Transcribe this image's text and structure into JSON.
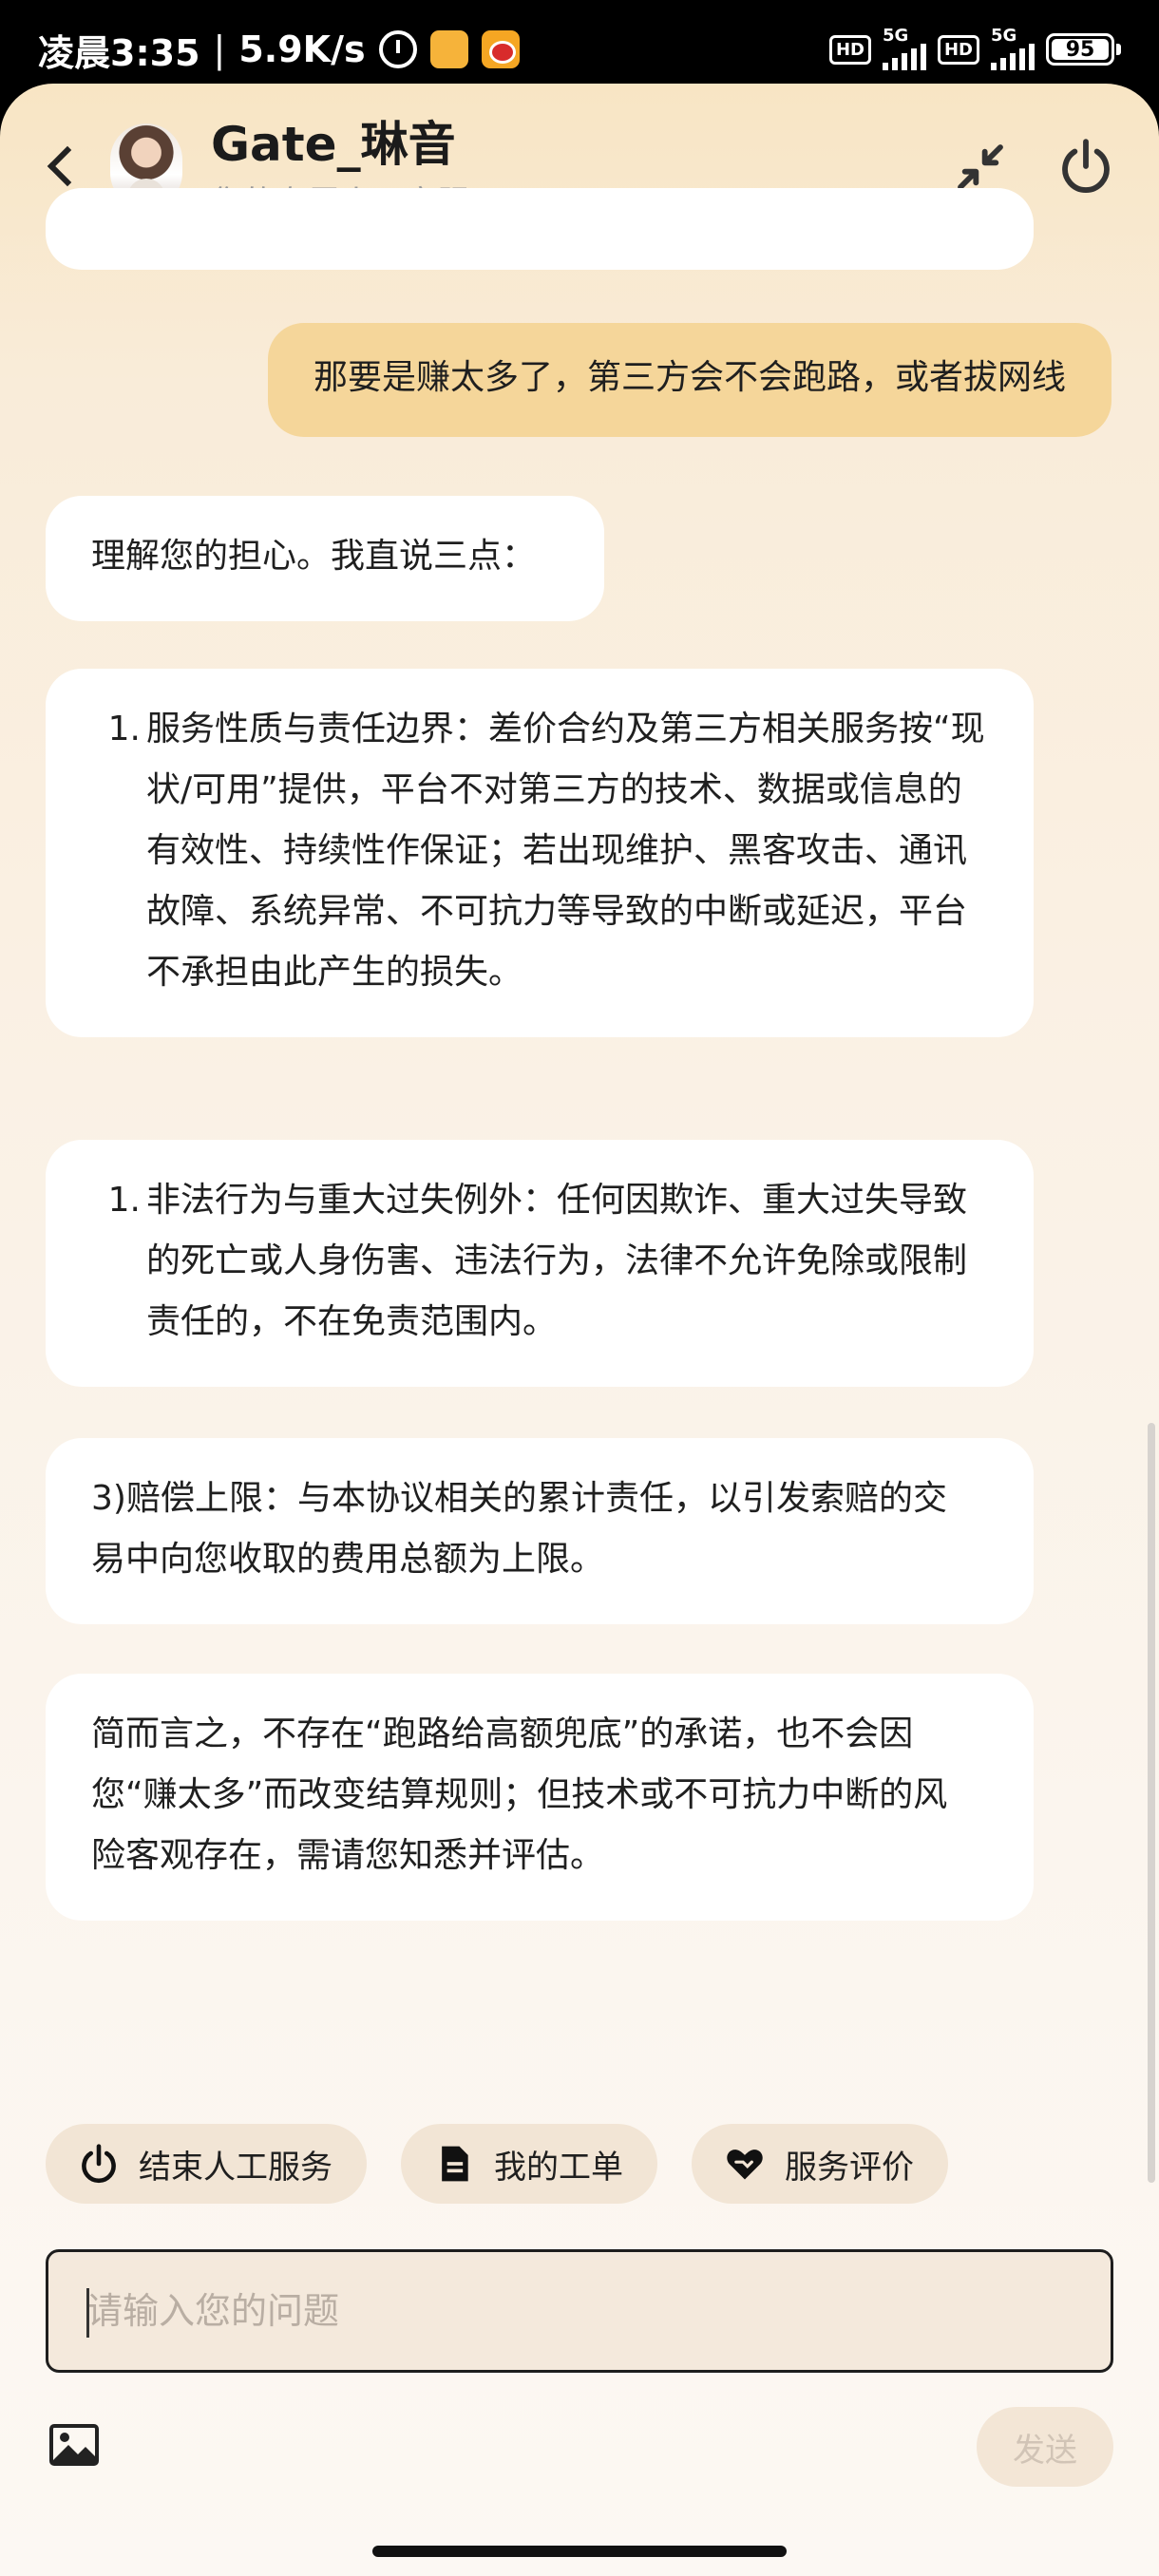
{
  "status_bar": {
    "time": "凌晨3:35",
    "net_speed": "5.9K/s",
    "hd1": "HD",
    "net1": "5G",
    "hd2": "HD",
    "net2": "5G",
    "battery": "95"
  },
  "header": {
    "agent_name": "Gate_琳音",
    "subtitle": "您的专属人工客服"
  },
  "messages": {
    "user_1": "那要是赚太多了，第三方会不会跑路，或者拔网线",
    "ai_1": "理解您的担心。我直说三点：",
    "ai_2_num": "1.",
    "ai_2": "服务性质与责任边界：差价合约及第三方相关服务按“现状/可用”提供，平台不对第三方的技术、数据或信息的有效性、持续性作保证；若出现维护、黑客攻击、通讯故障、系统异常、不可抗力等导致的中断或延迟，平台不承担由此产生的损失。",
    "ai_3_num": "1.",
    "ai_3": "非法行为与重大过失例外：任何因欺诈、重大过失导致的死亡或人身伤害、违法行为，法律不允许免除或限制责任的，不在免责范围内。",
    "ai_4": "3)赔偿上限：与本协议相关的累计责任，以引发索赔的交易中向您收取的费用总额为上限。",
    "ai_5": "简而言之，不存在“跑路给高额兜底”的承诺，也不会因您“赚太多”而改变结算规则；但技术或不可抗力中断的风险客观存在，需请您知悉并评估。"
  },
  "quick_actions": [
    {
      "label": "结束人工服务",
      "icon": "power-icon"
    },
    {
      "label": "我的工单",
      "icon": "document-icon"
    },
    {
      "label": "服务评价",
      "icon": "heart-handshake-icon"
    }
  ],
  "input": {
    "placeholder": "请输入您的问题",
    "value": ""
  },
  "send_label": "发送",
  "colors": {
    "user_bubble": "#f5d69a",
    "ai_bubble": "#ffffff",
    "header_bg": "#f8e5c4",
    "chip_bg": "#f2e5d5"
  }
}
